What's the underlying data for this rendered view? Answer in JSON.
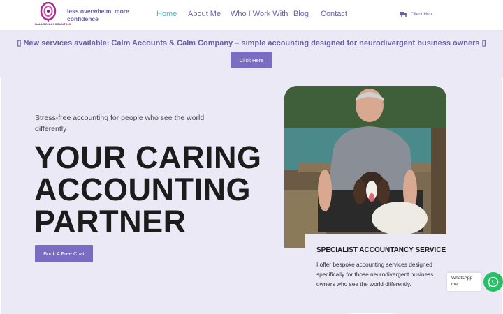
{
  "header": {
    "logo_text": "BALLOON ACCOUNTING",
    "tagline": "less overwhelm, more confidence",
    "nav": [
      {
        "label": "Home",
        "active": true
      },
      {
        "label": "About Me",
        "active": false
      },
      {
        "label": "Who I Work With",
        "active": false
      },
      {
        "label": "Blog",
        "active": false
      },
      {
        "label": "Contact",
        "active": false
      }
    ],
    "client_hub": "Client Hub",
    "client_hub_icon": "truck-icon"
  },
  "announcement": {
    "text": "▯ New services available: Calm Accounts & Calm Company – simple accounting designed for neurodivergent business owners ▯",
    "button": "Click Here"
  },
  "hero": {
    "subtitle": "Stress-free accounting for people who see the world differently",
    "headline_lines": [
      "YOUR CARING",
      "ACCOUNTING",
      "PARTNER"
    ],
    "button": "Book A Free Chat"
  },
  "card": {
    "title": "SPECIALIST ACCOUNTANCY SERVICE",
    "text": "I offer bespoke accounting services designed specifically for those neurodivergent business owners who see the world differently."
  },
  "whatsapp": {
    "label": "WhatsApp me",
    "icon": "whatsapp-icon"
  },
  "colors": {
    "brand_purple": "#6a5fa8",
    "button_purple": "#7a6cc0",
    "nav_active": "#4fb6c0",
    "hero_bg": "#ece9f7",
    "whatsapp_green": "#25c063"
  }
}
